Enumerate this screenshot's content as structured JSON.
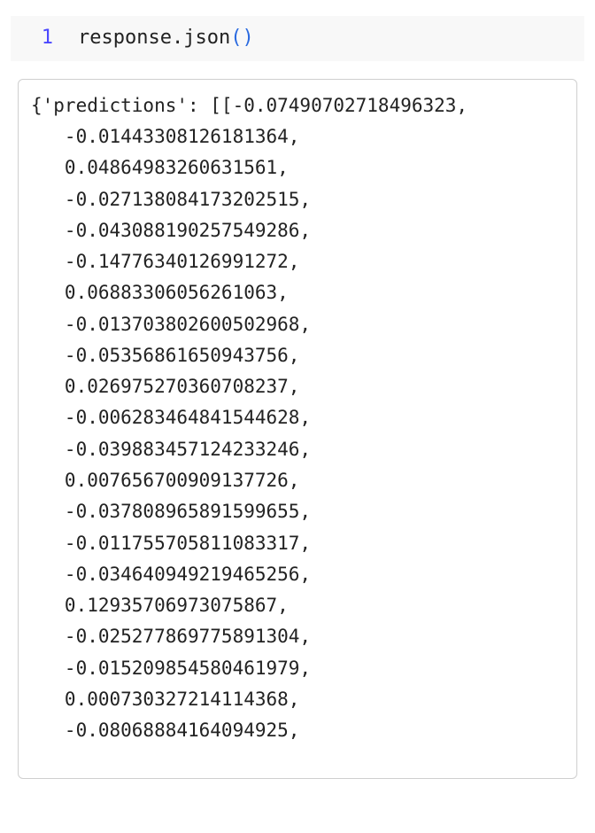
{
  "code_cell": {
    "line_number": "1",
    "code_object": "response",
    "code_dot": ".",
    "code_method": "json",
    "code_open": "(",
    "code_close": ")"
  },
  "output": {
    "lines": [
      "{'predictions': [[-0.07490702718496323,",
      "   -0.01443308126181364,",
      "   0.04864983260631561,",
      "   -0.027138084173202515,",
      "   -0.043088190257549286,",
      "   -0.14776340126991272,",
      "   0.06883306056261063,",
      "   -0.013703802600502968,",
      "   -0.05356861650943756,",
      "   0.026975270360708237,",
      "   -0.006283464841544628,",
      "   -0.039883457124233246,",
      "   0.007656700909137726,",
      "   -0.037808965891599655,",
      "   -0.011755705811083317,",
      "   -0.034640949219465256,",
      "   0.12935706973075867,",
      "   -0.025277869775891304,",
      "   -0.015209854580461979,",
      "   0.000730327214114368,",
      "   -0.08068884164094925,"
    ]
  }
}
